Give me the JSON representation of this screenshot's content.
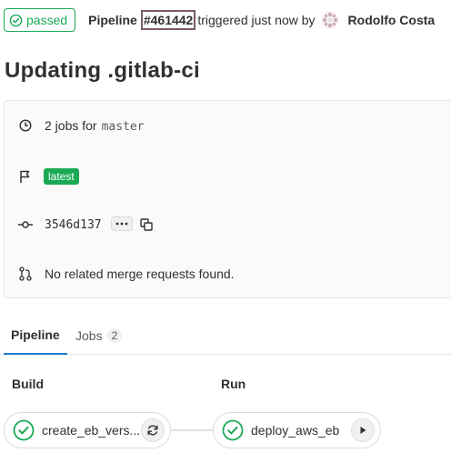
{
  "header": {
    "status_label": "passed",
    "pipeline_label": "Pipeline",
    "pipeline_id": "#461442",
    "triggered_text": "triggered just now by",
    "author_name": "Rodolfo Costa"
  },
  "title": "Updating .gitlab-ci",
  "info": {
    "jobs_text": "2 jobs for",
    "branch": "master",
    "latest_badge": "latest",
    "commit_sha": "3546d137",
    "mr_text": "No related merge requests found."
  },
  "tabs": [
    {
      "label": "Pipeline",
      "active": true
    },
    {
      "label": "Jobs",
      "count": "2"
    }
  ],
  "stages": [
    {
      "name": "Build",
      "jobs": [
        {
          "name": "create_eb_vers...",
          "action_icon": "retry-icon",
          "status": "passed"
        }
      ]
    },
    {
      "name": "Run",
      "jobs": [
        {
          "name": "deploy_aws_eb",
          "action_icon": "play-icon",
          "status": "passed"
        }
      ]
    }
  ],
  "colors": {
    "success": "#1aaa55",
    "text": "#303030",
    "active_tab": "#1f78d1"
  }
}
